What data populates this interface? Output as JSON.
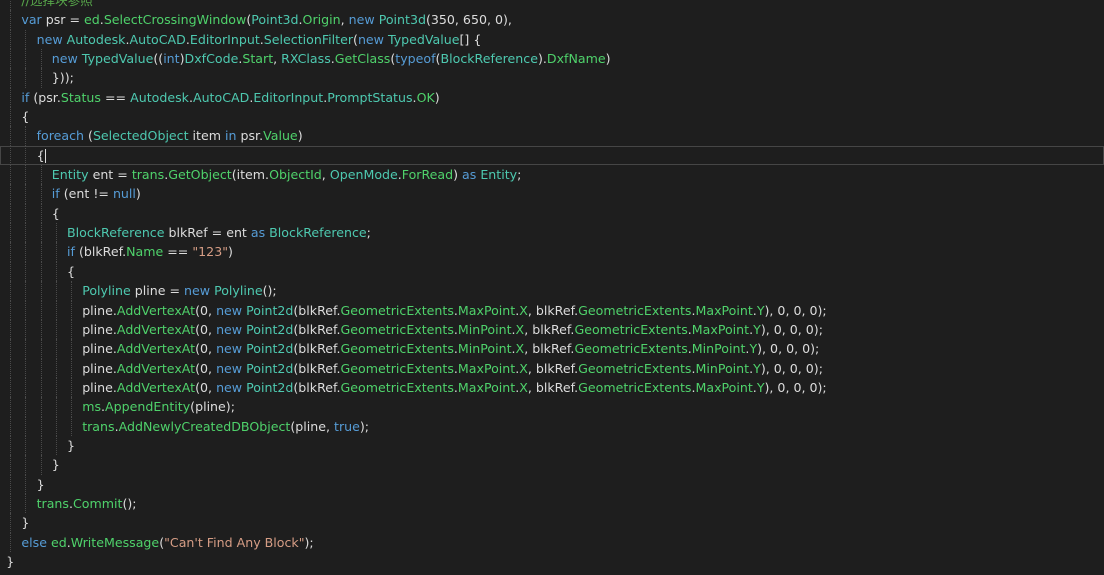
{
  "editor": {
    "current_line_index": 8,
    "lines": [
      {
        "indent": 2,
        "tokens": [
          [
            "cm",
            "//选择块参照"
          ]
        ]
      },
      {
        "indent": 2,
        "tokens": [
          [
            "kw",
            "var"
          ],
          [
            "df",
            " psr = "
          ],
          [
            "mb",
            "ed"
          ],
          [
            "df",
            "."
          ],
          [
            "mb",
            "SelectCrossingWindow"
          ],
          [
            "df",
            "("
          ],
          [
            "ty",
            "Point3d"
          ],
          [
            "df",
            "."
          ],
          [
            "mb",
            "Origin"
          ],
          [
            "df",
            ", "
          ],
          [
            "kw",
            "new"
          ],
          [
            "df",
            " "
          ],
          [
            "ty",
            "Point3d"
          ],
          [
            "df",
            "(350, 650, 0),"
          ]
        ]
      },
      {
        "indent": 3,
        "tokens": [
          [
            "kw",
            "new"
          ],
          [
            "df",
            " "
          ],
          [
            "ty",
            "Autodesk"
          ],
          [
            "df",
            "."
          ],
          [
            "ty",
            "AutoCAD"
          ],
          [
            "df",
            "."
          ],
          [
            "ty",
            "EditorInput"
          ],
          [
            "df",
            "."
          ],
          [
            "ty",
            "SelectionFilter"
          ],
          [
            "df",
            "("
          ],
          [
            "kw",
            "new"
          ],
          [
            "df",
            " "
          ],
          [
            "ty",
            "TypedValue"
          ],
          [
            "df",
            "[] {"
          ]
        ]
      },
      {
        "indent": 4,
        "tokens": [
          [
            "kw",
            "new"
          ],
          [
            "df",
            " "
          ],
          [
            "ty",
            "TypedValue"
          ],
          [
            "df",
            "(("
          ],
          [
            "kw",
            "int"
          ],
          [
            "df",
            ")"
          ],
          [
            "ty",
            "DxfCode"
          ],
          [
            "df",
            "."
          ],
          [
            "mb",
            "Start"
          ],
          [
            "df",
            ", "
          ],
          [
            "ty",
            "RXClass"
          ],
          [
            "df",
            "."
          ],
          [
            "mb",
            "GetClass"
          ],
          [
            "df",
            "("
          ],
          [
            "kw",
            "typeof"
          ],
          [
            "df",
            "("
          ],
          [
            "ty",
            "BlockReference"
          ],
          [
            "df",
            ")."
          ],
          [
            "mb",
            "DxfName"
          ],
          [
            "df",
            ")"
          ]
        ]
      },
      {
        "indent": 4,
        "tokens": [
          [
            "df",
            "}));"
          ]
        ]
      },
      {
        "indent": 2,
        "tokens": [
          [
            "kw",
            "if"
          ],
          [
            "df",
            " (psr."
          ],
          [
            "mb",
            "Status"
          ],
          [
            "df",
            " == "
          ],
          [
            "ty",
            "Autodesk"
          ],
          [
            "df",
            "."
          ],
          [
            "ty",
            "AutoCAD"
          ],
          [
            "df",
            "."
          ],
          [
            "ty",
            "EditorInput"
          ],
          [
            "df",
            "."
          ],
          [
            "ty",
            "PromptStatus"
          ],
          [
            "df",
            "."
          ],
          [
            "mb",
            "OK"
          ],
          [
            "df",
            ")"
          ]
        ]
      },
      {
        "indent": 2,
        "tokens": [
          [
            "df",
            "{"
          ]
        ]
      },
      {
        "indent": 3,
        "tokens": [
          [
            "kw",
            "foreach"
          ],
          [
            "df",
            " ("
          ],
          [
            "ty",
            "SelectedObject"
          ],
          [
            "df",
            " item "
          ],
          [
            "kw",
            "in"
          ],
          [
            "df",
            " psr."
          ],
          [
            "mb",
            "Value"
          ],
          [
            "df",
            ")"
          ]
        ]
      },
      {
        "indent": 3,
        "tokens": [
          [
            "df",
            "{"
          ]
        ]
      },
      {
        "indent": 4,
        "tokens": [
          [
            "ty",
            "Entity"
          ],
          [
            "df",
            " ent = "
          ],
          [
            "mb",
            "trans"
          ],
          [
            "df",
            "."
          ],
          [
            "mb",
            "GetObject"
          ],
          [
            "df",
            "(item."
          ],
          [
            "mb",
            "ObjectId"
          ],
          [
            "df",
            ", "
          ],
          [
            "ty",
            "OpenMode"
          ],
          [
            "df",
            "."
          ],
          [
            "mb",
            "ForRead"
          ],
          [
            "df",
            ") "
          ],
          [
            "kw",
            "as"
          ],
          [
            "df",
            " "
          ],
          [
            "ty",
            "Entity"
          ],
          [
            "df",
            ";"
          ]
        ]
      },
      {
        "indent": 4,
        "tokens": [
          [
            "kw",
            "if"
          ],
          [
            "df",
            " (ent != "
          ],
          [
            "kw",
            "null"
          ],
          [
            "df",
            ")"
          ]
        ]
      },
      {
        "indent": 4,
        "tokens": [
          [
            "df",
            "{"
          ]
        ]
      },
      {
        "indent": 5,
        "tokens": [
          [
            "ty",
            "BlockReference"
          ],
          [
            "df",
            " blkRef = ent "
          ],
          [
            "kw",
            "as"
          ],
          [
            "df",
            " "
          ],
          [
            "ty",
            "BlockReference"
          ],
          [
            "df",
            ";"
          ]
        ]
      },
      {
        "indent": 5,
        "tokens": [
          [
            "kw",
            "if"
          ],
          [
            "df",
            " (blkRef."
          ],
          [
            "mb",
            "Name"
          ],
          [
            "df",
            " == "
          ],
          [
            "st",
            "\"123\""
          ],
          [
            "df",
            ")"
          ]
        ]
      },
      {
        "indent": 5,
        "tokens": [
          [
            "df",
            "{"
          ]
        ]
      },
      {
        "indent": 6,
        "tokens": [
          [
            "ty",
            "Polyline"
          ],
          [
            "df",
            " pline = "
          ],
          [
            "kw",
            "new"
          ],
          [
            "df",
            " "
          ],
          [
            "ty",
            "Polyline"
          ],
          [
            "df",
            "();"
          ]
        ]
      },
      {
        "indent": 6,
        "tokens": [
          [
            "df",
            "pline."
          ],
          [
            "mb",
            "AddVertexAt"
          ],
          [
            "df",
            "(0, "
          ],
          [
            "kw",
            "new"
          ],
          [
            "df",
            " "
          ],
          [
            "ty",
            "Point2d"
          ],
          [
            "df",
            "(blkRef."
          ],
          [
            "mb",
            "GeometricExtents"
          ],
          [
            "df",
            "."
          ],
          [
            "mb",
            "MaxPoint"
          ],
          [
            "df",
            "."
          ],
          [
            "mb",
            "X"
          ],
          [
            "df",
            ", blkRef."
          ],
          [
            "mb",
            "GeometricExtents"
          ],
          [
            "df",
            "."
          ],
          [
            "mb",
            "MaxPoint"
          ],
          [
            "df",
            "."
          ],
          [
            "mb",
            "Y"
          ],
          [
            "df",
            "), 0, 0, 0);"
          ]
        ]
      },
      {
        "indent": 6,
        "tokens": [
          [
            "df",
            "pline."
          ],
          [
            "mb",
            "AddVertexAt"
          ],
          [
            "df",
            "(0, "
          ],
          [
            "kw",
            "new"
          ],
          [
            "df",
            " "
          ],
          [
            "ty",
            "Point2d"
          ],
          [
            "df",
            "(blkRef."
          ],
          [
            "mb",
            "GeometricExtents"
          ],
          [
            "df",
            "."
          ],
          [
            "mb",
            "MinPoint"
          ],
          [
            "df",
            "."
          ],
          [
            "mb",
            "X"
          ],
          [
            "df",
            ", blkRef."
          ],
          [
            "mb",
            "GeometricExtents"
          ],
          [
            "df",
            "."
          ],
          [
            "mb",
            "MaxPoint"
          ],
          [
            "df",
            "."
          ],
          [
            "mb",
            "Y"
          ],
          [
            "df",
            "), 0, 0, 0);"
          ]
        ]
      },
      {
        "indent": 6,
        "tokens": [
          [
            "df",
            "pline."
          ],
          [
            "mb",
            "AddVertexAt"
          ],
          [
            "df",
            "(0, "
          ],
          [
            "kw",
            "new"
          ],
          [
            "df",
            " "
          ],
          [
            "ty",
            "Point2d"
          ],
          [
            "df",
            "(blkRef."
          ],
          [
            "mb",
            "GeometricExtents"
          ],
          [
            "df",
            "."
          ],
          [
            "mb",
            "MinPoint"
          ],
          [
            "df",
            "."
          ],
          [
            "mb",
            "X"
          ],
          [
            "df",
            ", blkRef."
          ],
          [
            "mb",
            "GeometricExtents"
          ],
          [
            "df",
            "."
          ],
          [
            "mb",
            "MinPoint"
          ],
          [
            "df",
            "."
          ],
          [
            "mb",
            "Y"
          ],
          [
            "df",
            "), 0, 0, 0);"
          ]
        ]
      },
      {
        "indent": 6,
        "tokens": [
          [
            "df",
            "pline."
          ],
          [
            "mb",
            "AddVertexAt"
          ],
          [
            "df",
            "(0, "
          ],
          [
            "kw",
            "new"
          ],
          [
            "df",
            " "
          ],
          [
            "ty",
            "Point2d"
          ],
          [
            "df",
            "(blkRef."
          ],
          [
            "mb",
            "GeometricExtents"
          ],
          [
            "df",
            "."
          ],
          [
            "mb",
            "MaxPoint"
          ],
          [
            "df",
            "."
          ],
          [
            "mb",
            "X"
          ],
          [
            "df",
            ", blkRef."
          ],
          [
            "mb",
            "GeometricExtents"
          ],
          [
            "df",
            "."
          ],
          [
            "mb",
            "MinPoint"
          ],
          [
            "df",
            "."
          ],
          [
            "mb",
            "Y"
          ],
          [
            "df",
            "), 0, 0, 0);"
          ]
        ]
      },
      {
        "indent": 6,
        "tokens": [
          [
            "df",
            "pline."
          ],
          [
            "mb",
            "AddVertexAt"
          ],
          [
            "df",
            "(0, "
          ],
          [
            "kw",
            "new"
          ],
          [
            "df",
            " "
          ],
          [
            "ty",
            "Point2d"
          ],
          [
            "df",
            "(blkRef."
          ],
          [
            "mb",
            "GeometricExtents"
          ],
          [
            "df",
            "."
          ],
          [
            "mb",
            "MaxPoint"
          ],
          [
            "df",
            "."
          ],
          [
            "mb",
            "X"
          ],
          [
            "df",
            ", blkRef."
          ],
          [
            "mb",
            "GeometricExtents"
          ],
          [
            "df",
            "."
          ],
          [
            "mb",
            "MaxPoint"
          ],
          [
            "df",
            "."
          ],
          [
            "mb",
            "Y"
          ],
          [
            "df",
            "), 0, 0, 0);"
          ]
        ]
      },
      {
        "indent": 6,
        "tokens": [
          [
            "mb",
            "ms"
          ],
          [
            "df",
            "."
          ],
          [
            "mb",
            "AppendEntity"
          ],
          [
            "df",
            "(pline);"
          ]
        ]
      },
      {
        "indent": 6,
        "tokens": [
          [
            "mb",
            "trans"
          ],
          [
            "df",
            "."
          ],
          [
            "mb",
            "AddNewlyCreatedDBObject"
          ],
          [
            "df",
            "(pline, "
          ],
          [
            "kw",
            "true"
          ],
          [
            "df",
            ");"
          ]
        ]
      },
      {
        "indent": 5,
        "tokens": [
          [
            "df",
            "}"
          ]
        ]
      },
      {
        "indent": 4,
        "tokens": [
          [
            "df",
            "}"
          ]
        ]
      },
      {
        "indent": 3,
        "tokens": [
          [
            "df",
            "}"
          ]
        ]
      },
      {
        "indent": 3,
        "tokens": [
          [
            "mb",
            "trans"
          ],
          [
            "df",
            "."
          ],
          [
            "mb",
            "Commit"
          ],
          [
            "df",
            "();"
          ]
        ]
      },
      {
        "indent": 2,
        "tokens": [
          [
            "df",
            "}"
          ]
        ]
      },
      {
        "indent": 2,
        "tokens": [
          [
            "kw",
            "else"
          ],
          [
            "df",
            " "
          ],
          [
            "mb",
            "ed"
          ],
          [
            "df",
            "."
          ],
          [
            "mb",
            "WriteMessage"
          ],
          [
            "df",
            "("
          ],
          [
            "st",
            "\"Can't Find Any Block\""
          ],
          [
            "df",
            ");"
          ]
        ]
      },
      {
        "indent": 1,
        "tokens": [
          [
            "df",
            "}"
          ]
        ]
      }
    ]
  }
}
